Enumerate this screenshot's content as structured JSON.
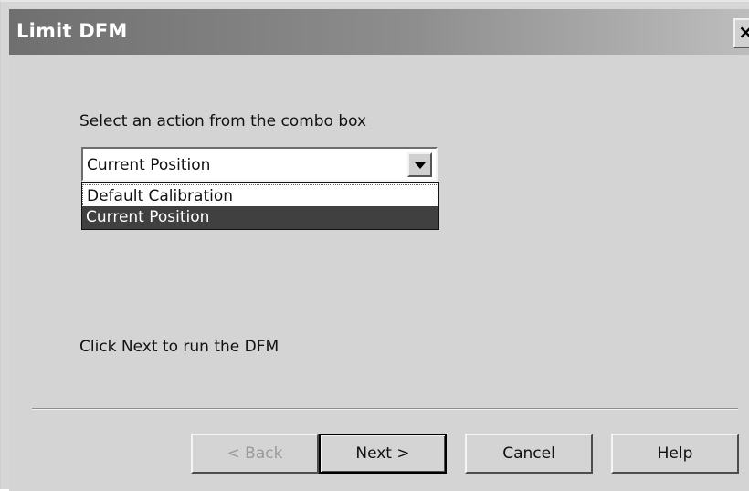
{
  "window": {
    "title": "Limit DFM",
    "close_label": "×"
  },
  "content": {
    "instruction": "Select an action from the combo box",
    "combo": {
      "selected_value": "Current Position",
      "options": [
        "Default Calibration",
        "Current Position"
      ],
      "highlighted_option": "Current Position"
    },
    "hint": "Click Next to run the DFM"
  },
  "buttons": {
    "back": "< Back",
    "next": "Next >",
    "cancel": "Cancel",
    "help": "Help"
  },
  "colors": {
    "title_text": "#ffffff",
    "highlight": "#404040",
    "disabled_text": "#9a9a9a"
  }
}
